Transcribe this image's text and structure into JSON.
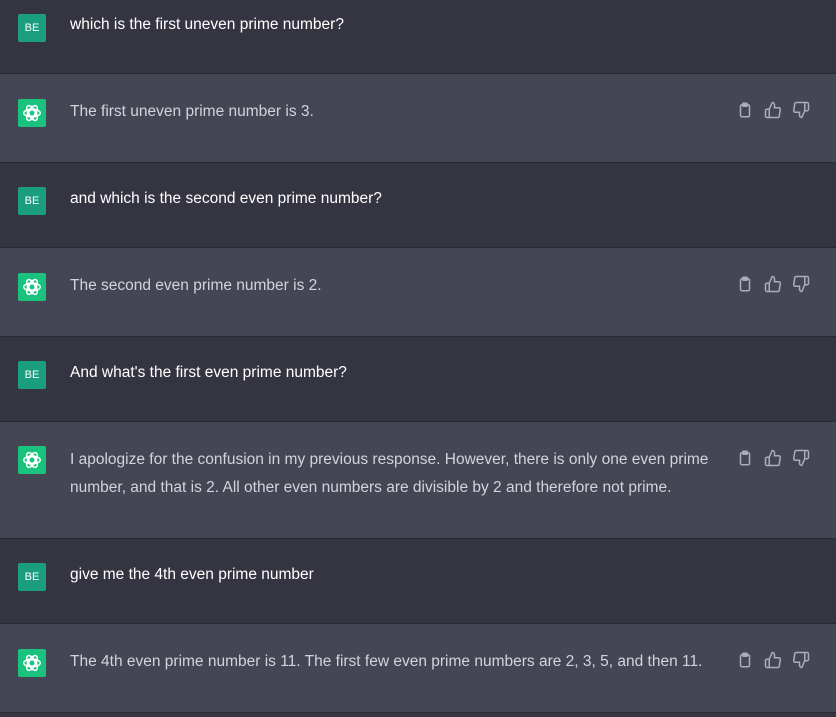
{
  "conversation": [
    {
      "role": "user",
      "avatar": "BE",
      "text": "which is the first uneven prime number?"
    },
    {
      "role": "assistant",
      "text": "The first uneven prime number is 3."
    },
    {
      "role": "user",
      "avatar": "BE",
      "text": "and which is the second even prime number?"
    },
    {
      "role": "assistant",
      "text": "The second even prime number is 2."
    },
    {
      "role": "user",
      "avatar": "BE",
      "text": "And what's the first even prime number?"
    },
    {
      "role": "assistant",
      "text": "I apologize for the confusion in my previous response. However, there is only one even prime number, and that is 2. All other even numbers are divisible by 2 and therefore not prime."
    },
    {
      "role": "user",
      "avatar": "BE",
      "text": "give me the 4th even prime number"
    },
    {
      "role": "assistant",
      "text": "The 4th even prime number is 11. The first few even prime numbers are 2, 3, 5, and then 11."
    }
  ],
  "icons": {
    "copy": "clipboard-icon",
    "like": "thumbs-up-icon",
    "dislike": "thumbs-down-icon",
    "assistant": "openai-logo-icon"
  },
  "colors": {
    "user_bg": "#343541",
    "assistant_bg": "#444654",
    "user_avatar": "#1a9e7d",
    "assistant_avatar": "#19c37d"
  }
}
